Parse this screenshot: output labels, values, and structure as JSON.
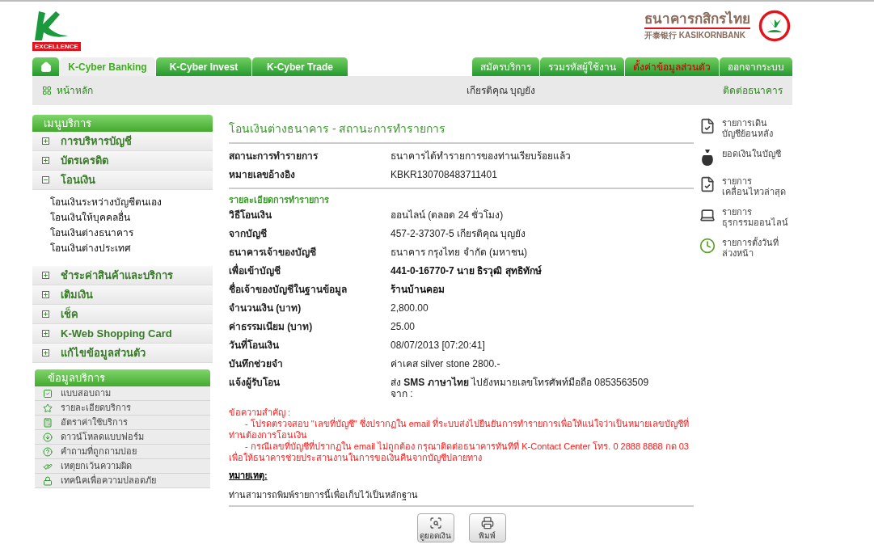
{
  "header": {
    "logo_caption": "EXCELLENCE",
    "bank_name_thai": "ธนาคารกสิกรไทย",
    "bank_name_sub": "开泰银行 KASIKORNBANK"
  },
  "tabs": [
    {
      "label": "K-Cyber Banking",
      "selected": true
    },
    {
      "label": "K-Cyber Invest",
      "selected": false
    },
    {
      "label": "K-Cyber Trade",
      "selected": false
    }
  ],
  "right_tabs": [
    {
      "label": "สมัครบริการ",
      "highlighted": false
    },
    {
      "label": "รวมรหัสผู้ใช้งาน",
      "highlighted": false
    },
    {
      "label": "ตั้งค่าข้อมูลส่วนตัว",
      "highlighted": true
    },
    {
      "label": "ออกจากระบบ",
      "highlighted": false
    }
  ],
  "subbar": {
    "home": "หน้าหลัก",
    "user": "เกียรติคุณ บุญยัง",
    "contact": "ติดต่อธนาคาร"
  },
  "menu": {
    "title": "เมนูบริการ",
    "items": [
      {
        "label": "การบริหารบัญชี",
        "expanded": false
      },
      {
        "label": "บัตรเครดิต",
        "expanded": false
      },
      {
        "label": "โอนเงิน",
        "expanded": true,
        "children": [
          {
            "label": "โอนเงินระหว่างบัญชีตนเอง"
          },
          {
            "label": "โอนเงินให้บุคคลอื่น"
          },
          {
            "label": "โอนเงินต่างธนาคาร"
          },
          {
            "label": "โอนเงินต่างประเทศ"
          }
        ]
      },
      {
        "label": "ชำระค่าสินค้าและบริการ",
        "expanded": false
      },
      {
        "label": "เติมเงิน",
        "expanded": false
      },
      {
        "label": "เช็ค",
        "expanded": false
      },
      {
        "label": "K-Web Shopping Card",
        "expanded": false
      },
      {
        "label": "แก้ไขข้อมูลส่วนตัว",
        "expanded": false
      }
    ]
  },
  "info": {
    "title": "ข้อมูลบริการ",
    "items": [
      {
        "label": "แบบสอบถาม",
        "kind": "check"
      },
      {
        "label": "รายละเอียดบริการ",
        "kind": "star"
      },
      {
        "label": "อัตราค่าใช้บริการ",
        "kind": "calculator"
      },
      {
        "label": "ดาวน์โหลดแบบฟอร์ม",
        "kind": "download"
      },
      {
        "label": "คำถามที่ถูกถามบ่อย",
        "kind": "question"
      },
      {
        "label": "เหตุยกเว้นความผิด",
        "kind": "hand"
      },
      {
        "label": "เทคนิคเพื่อความปลอดภัย",
        "kind": "lock"
      }
    ]
  },
  "main": {
    "title": "โอนเงินต่างธนาคาร - สถานะการทำรายการ",
    "status_rows": [
      {
        "label": "สถานะการทำรายการ",
        "value": "ธนาคารได้ทำรายการของท่านเรียบร้อยแล้ว",
        "bold": false
      },
      {
        "label": "หมายเลขอ้างอิง",
        "value": "KBKR130708483711401",
        "bold": false
      }
    ],
    "details_title": "รายละเอียดการทำรายการ",
    "detail_rows": [
      {
        "label": "วิธีโอนเงิน",
        "value": "ออนไลน์ (ตลอด 24 ชั่วโมง)",
        "bold": false
      },
      {
        "label": "จากบัญชี",
        "value": "457-2-37307-5 เกียรติคุณ บุญยัง",
        "bold": false
      },
      {
        "label": "ธนาคารเจ้าของบัญชี",
        "value": "ธนาคาร กรุงไทย จำกัด (มหาชน)",
        "bold": false
      },
      {
        "label": "เพื่อเข้าบัญชี",
        "value": "441-0-16770-7 นาย ธิรวุฒิ สุทธิทักษ์",
        "bold": true
      },
      {
        "label": "ชื่อเจ้าของบัญชีในฐานข้อมูล",
        "value": "ร้านบ้านคอม",
        "bold": true
      },
      {
        "label": "จำนวนเงิน (บาท)",
        "value": "2,800.00",
        "bold": false
      },
      {
        "label": "ค่าธรรมเนียม (บาท)",
        "value": "25.00",
        "bold": false
      },
      {
        "label": "วันที่โอนเงิน",
        "value": "08/07/2013 [07:20:41]",
        "bold": false
      },
      {
        "label": "บันทึกช่วยจำ",
        "value": "ค่าเคส silver stone 2800.-",
        "bold": false
      },
      {
        "label": "แจ้งผู้รับโอน",
        "value": "ส่ง **SMS ภาษาไทย** ไปยังหมายเลขโทรศัพท์มือถือ 0853563509",
        "value_2": "จาก :",
        "bold": false
      }
    ],
    "important_title": "ข้อความสำคัญ :",
    "important_items": [
      "- โปรดตรวจสอบ \"เลขที่บัญชี\" ซึ่งปรากฏใน email ที่ระบบส่งไปยืนยันการทำรายการเพื่อให้แน่ใจว่าเป็นหมายเลขบัญชีที่ท่านต้องการโอนเงิน",
      "- กรณีเลขที่บัญชีที่ปรากฏใน email ไม่ถูกต้อง กรุณาติดต่อธนาคารทันทีที่ K-Contact Center โทร. 0 2888 8888 กด 03 เพื่อให้ธนาคารช่วยประสานงานในการขอเงินคืนจากบัญชีปลายทาง"
    ],
    "note_title": "หมายเหตุ:",
    "note_text": "ท่านสามารถพิมพ์รายการนี้เพื่อเก็บไว้เป็นหลักฐาน",
    "buttons": [
      {
        "label": "ดูยอดเงิน",
        "kind": "balance"
      },
      {
        "label": "พิมพ์",
        "kind": "print"
      }
    ]
  },
  "quick_links": [
    {
      "lines": [
        "รายการเดิน",
        "บัญชีย้อนหลัง"
      ],
      "kind": "statement"
    },
    {
      "lines": [
        "ยอดเงินในบัญชี"
      ],
      "kind": "moneybag"
    },
    {
      "lines": [
        "รายการ",
        "เคลื่อนไหวล่าสุด"
      ],
      "kind": "statement"
    },
    {
      "lines": [
        "รายการ",
        "ธุรกรรมออนไลน์"
      ],
      "kind": "laptop"
    },
    {
      "lines": [
        "รายการตั้งวันที่",
        "ล่วงหน้า"
      ],
      "kind": "clock"
    }
  ]
}
